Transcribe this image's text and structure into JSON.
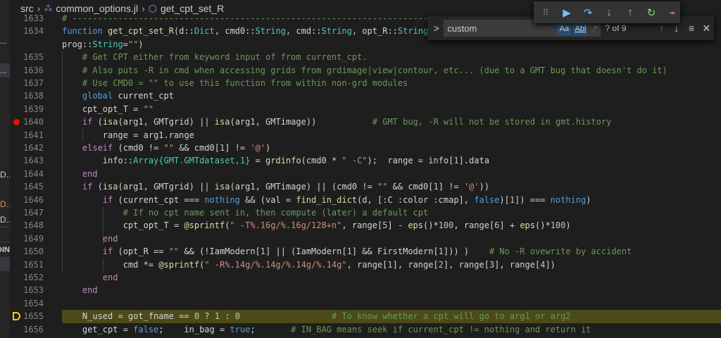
{
  "breadcrumb": {
    "folder": "src",
    "file": "common_options.jl",
    "symbol": "get_cpt_set_R"
  },
  "sidebar": {
    "items": [
      "...",
      "...",
      "D...",
      "D...",
      "D...",
      "DIN"
    ]
  },
  "find": {
    "toggle": ">",
    "query": "custom",
    "match_case": "Aa",
    "whole_word": "Abl",
    "regex": ".*",
    "count": "? of 9",
    "prev": "↑",
    "next": "↓",
    "in_selection": "≡",
    "close": "✕"
  },
  "debug_toolbar": {
    "grip": "⠿",
    "continue": "▶",
    "step_over": "↷",
    "step_into": "↓",
    "step_out": "↑",
    "restart": "↻",
    "disconnect": "⌁"
  },
  "colors": {
    "breakpoint": "#e51400",
    "current_line": "#4b4a19",
    "accent": "#75beff"
  },
  "editor": {
    "breakpoint_line": "1640",
    "current_line": "1655",
    "lines": [
      {
        "num": "1633",
        "tokens": [
          [
            "c",
            "# -------------------------------------------------------------------------------------------------------------------"
          ]
        ]
      },
      {
        "num": "1634",
        "tokens": [
          [
            "b",
            "function"
          ],
          [
            "p",
            " "
          ],
          [
            "f",
            "get_cpt_set_R"
          ],
          [
            "p",
            "(d::"
          ],
          [
            "t",
            "Dict"
          ],
          [
            "p",
            ", cmd0::"
          ],
          [
            "t",
            "String"
          ],
          [
            "p",
            ", cmd::"
          ],
          [
            "t",
            "String"
          ],
          [
            "p",
            ", opt_R::"
          ],
          [
            "t",
            "String"
          ]
        ]
      },
      {
        "num": "",
        "tokens": [
          [
            "p",
            "prog::"
          ],
          [
            "t",
            "String"
          ],
          [
            "p",
            "="
          ],
          [
            "s",
            "\"\""
          ],
          [
            "p",
            ")"
          ]
        ]
      },
      {
        "num": "1635",
        "tokens": [
          [
            "p",
            "    "
          ],
          [
            "c",
            "# Get CPT either from keyword input of from current_cpt."
          ]
        ]
      },
      {
        "num": "1636",
        "tokens": [
          [
            "p",
            "    "
          ],
          [
            "c",
            "# Also puts -R in cmd when accessing grids from grdimage|view|contour, etc... (due to a GMT bug that doesn't do it)"
          ]
        ]
      },
      {
        "num": "1637",
        "tokens": [
          [
            "p",
            "    "
          ],
          [
            "c",
            "# Use CMD0 = \"\" to use this function from within non-grd modules"
          ]
        ]
      },
      {
        "num": "1638",
        "tokens": [
          [
            "p",
            "    "
          ],
          [
            "b",
            "global"
          ],
          [
            "p",
            " current_cpt"
          ]
        ]
      },
      {
        "num": "1639",
        "tokens": [
          [
            "p",
            "    cpt_opt_T = "
          ],
          [
            "s",
            "\"\""
          ]
        ]
      },
      {
        "num": "1640",
        "tokens": [
          [
            "p",
            "    "
          ],
          [
            "k",
            "if"
          ],
          [
            "p",
            " ("
          ],
          [
            "f",
            "isa"
          ],
          [
            "p",
            "(arg1, GMTgrid) || "
          ],
          [
            "f",
            "isa"
          ],
          [
            "p",
            "(arg1, GMTimage))           "
          ],
          [
            "c",
            "# GMT bug, -R will not be stored in gmt.history"
          ]
        ]
      },
      {
        "num": "1641",
        "tokens": [
          [
            "p",
            "        range = arg1.range"
          ]
        ]
      },
      {
        "num": "1642",
        "tokens": [
          [
            "p",
            "    "
          ],
          [
            "k",
            "elseif"
          ],
          [
            "p",
            " (cmd0 != "
          ],
          [
            "s",
            "\"\""
          ],
          [
            "p",
            " && cmd0["
          ],
          [
            "n",
            "1"
          ],
          [
            "p",
            "] != "
          ],
          [
            "s",
            "'@'"
          ],
          [
            "p",
            ")"
          ]
        ]
      },
      {
        "num": "1643",
        "tokens": [
          [
            "p",
            "        info::"
          ],
          [
            "t",
            "Array{GMT.GMTdataset,1}"
          ],
          [
            "p",
            " = "
          ],
          [
            "f",
            "grdinfo"
          ],
          [
            "p",
            "(cmd0 * "
          ],
          [
            "s",
            "\" -C\""
          ],
          [
            "p",
            ");  range = info["
          ],
          [
            "n",
            "1"
          ],
          [
            "p",
            "].data"
          ]
        ]
      },
      {
        "num": "1644",
        "tokens": [
          [
            "p",
            "    "
          ],
          [
            "k",
            "end"
          ]
        ]
      },
      {
        "num": "1645",
        "tokens": [
          [
            "p",
            "    "
          ],
          [
            "k",
            "if"
          ],
          [
            "p",
            " ("
          ],
          [
            "f",
            "isa"
          ],
          [
            "p",
            "(arg1, GMTgrid) || "
          ],
          [
            "f",
            "isa"
          ],
          [
            "p",
            "(arg1, GMTimage) || (cmd0 != "
          ],
          [
            "s",
            "\"\""
          ],
          [
            "p",
            " && cmd0["
          ],
          [
            "n",
            "1"
          ],
          [
            "p",
            "] != "
          ],
          [
            "s",
            "'@'"
          ],
          [
            "p",
            "))"
          ]
        ]
      },
      {
        "num": "1646",
        "tokens": [
          [
            "p",
            "        "
          ],
          [
            "k",
            "if"
          ],
          [
            "p",
            " (current_cpt === "
          ],
          [
            "b",
            "nothing"
          ],
          [
            "p",
            " && (val = "
          ],
          [
            "f",
            "find_in_dict"
          ],
          [
            "p",
            "(d, [:C :color :cmap], "
          ],
          [
            "b",
            "false"
          ],
          [
            "p",
            ")["
          ],
          [
            "n",
            "1"
          ],
          [
            "p",
            "]) === "
          ],
          [
            "b",
            "nothing"
          ],
          [
            "p",
            ")"
          ]
        ]
      },
      {
        "num": "1647",
        "tokens": [
          [
            "p",
            "            "
          ],
          [
            "c",
            "# If no cpt name sent in, then compute (later) a default cpt"
          ]
        ]
      },
      {
        "num": "1648",
        "tokens": [
          [
            "p",
            "            cpt_opt_T = "
          ],
          [
            "f",
            "@sprintf"
          ],
          [
            "p",
            "("
          ],
          [
            "s",
            "\" -T%.16g/%.16g/128+n\""
          ],
          [
            "p",
            ", range["
          ],
          [
            "n",
            "5"
          ],
          [
            "p",
            "] - "
          ],
          [
            "f",
            "eps"
          ],
          [
            "p",
            "()*"
          ],
          [
            "n",
            "100"
          ],
          [
            "p",
            ", range["
          ],
          [
            "n",
            "6"
          ],
          [
            "p",
            "] + "
          ],
          [
            "f",
            "eps"
          ],
          [
            "p",
            "()*"
          ],
          [
            "n",
            "100"
          ],
          [
            "p",
            ")"
          ]
        ]
      },
      {
        "num": "1649",
        "tokens": [
          [
            "p",
            "        "
          ],
          [
            "k",
            "end"
          ]
        ]
      },
      {
        "num": "1650",
        "tokens": [
          [
            "p",
            "        "
          ],
          [
            "k",
            "if"
          ],
          [
            "p",
            " (opt_R == "
          ],
          [
            "s",
            "\"\""
          ],
          [
            "p",
            " && (!IamModern["
          ],
          [
            "n",
            "1"
          ],
          [
            "p",
            "] || (IamModern["
          ],
          [
            "n",
            "1"
          ],
          [
            "p",
            "] && FirstModern["
          ],
          [
            "n",
            "1"
          ],
          [
            "p",
            "])) )    "
          ],
          [
            "c",
            "# No -R ovewrite by accident"
          ]
        ]
      },
      {
        "num": "1651",
        "tokens": [
          [
            "p",
            "            cmd *= "
          ],
          [
            "f",
            "@sprintf"
          ],
          [
            "p",
            "("
          ],
          [
            "s",
            "\" -R%.14g/%.14g/%.14g/%.14g\""
          ],
          [
            "p",
            ", range["
          ],
          [
            "n",
            "1"
          ],
          [
            "p",
            "], range["
          ],
          [
            "n",
            "2"
          ],
          [
            "p",
            "], range["
          ],
          [
            "n",
            "3"
          ],
          [
            "p",
            "], range["
          ],
          [
            "n",
            "4"
          ],
          [
            "p",
            "])"
          ]
        ]
      },
      {
        "num": "1652",
        "tokens": [
          [
            "p",
            "        "
          ],
          [
            "k",
            "end"
          ]
        ]
      },
      {
        "num": "1653",
        "tokens": [
          [
            "p",
            "    "
          ],
          [
            "k",
            "end"
          ]
        ]
      },
      {
        "num": "1654",
        "tokens": []
      },
      {
        "num": "1655",
        "tokens": [
          [
            "p",
            "    N_used = got_fname == "
          ],
          [
            "n",
            "0"
          ],
          [
            "p",
            " ? "
          ],
          [
            "n",
            "1"
          ],
          [
            "p",
            " : "
          ],
          [
            "n",
            "0"
          ],
          [
            "p",
            "                  "
          ],
          [
            "c",
            "# To know whether a cpt will go to arg1 or arg2"
          ]
        ]
      },
      {
        "num": "1656",
        "tokens": [
          [
            "p",
            "    get_cpt = "
          ],
          [
            "b",
            "false"
          ],
          [
            "p",
            ";    in_bag = "
          ],
          [
            "b",
            "true"
          ],
          [
            "p",
            ";       "
          ],
          [
            "c",
            "# IN_BAG means seek if current_cpt != nothing and return it"
          ]
        ]
      }
    ]
  }
}
